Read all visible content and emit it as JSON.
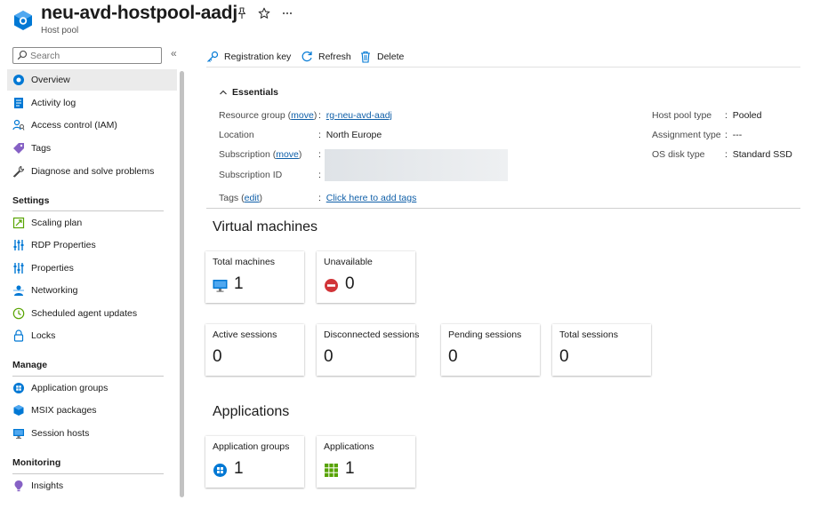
{
  "header": {
    "title": "neu-avd-hostpool-aadj",
    "subtitle": "Host pool"
  },
  "sidebar": {
    "search_placeholder": "Search",
    "collapse_glyph": "«",
    "items_top": [
      {
        "label": "Overview",
        "icon": "hostpool-icon"
      },
      {
        "label": "Activity log",
        "icon": "activity-log-icon"
      },
      {
        "label": "Access control (IAM)",
        "icon": "iam-icon"
      },
      {
        "label": "Tags",
        "icon": "tag-icon"
      },
      {
        "label": "Diagnose and solve problems",
        "icon": "wrench-icon"
      }
    ],
    "sections": [
      {
        "heading": "Settings",
        "items": [
          {
            "label": "Scaling plan",
            "icon": "scaling-plan-icon"
          },
          {
            "label": "RDP Properties",
            "icon": "sliders-icon"
          },
          {
            "label": "Properties",
            "icon": "sliders-icon"
          },
          {
            "label": "Networking",
            "icon": "network-icon"
          },
          {
            "label": "Scheduled agent updates",
            "icon": "clock-icon"
          },
          {
            "label": "Locks",
            "icon": "lock-icon"
          }
        ]
      },
      {
        "heading": "Manage",
        "items": [
          {
            "label": "Application groups",
            "icon": "app-group-icon"
          },
          {
            "label": "MSIX packages",
            "icon": "package-icon"
          },
          {
            "label": "Session hosts",
            "icon": "monitor-icon"
          }
        ]
      },
      {
        "heading": "Monitoring",
        "items": [
          {
            "label": "Insights",
            "icon": "insights-icon"
          }
        ]
      }
    ]
  },
  "toolbar": {
    "registration_key": "Registration key",
    "refresh": "Refresh",
    "delete": "Delete"
  },
  "essentials": {
    "toggle_label": "Essentials",
    "resource_group_label": "Resource group",
    "resource_group_link": "move",
    "resource_group_value": "rg-neu-avd-aadj",
    "location_label": "Location",
    "location_value": "North Europe",
    "subscription_label": "Subscription",
    "subscription_link": "move",
    "subscription_id_label": "Subscription ID",
    "tags_label": "Tags",
    "tags_edit": "edit",
    "tags_value": "Click here to add tags",
    "host_pool_type_label": "Host pool type",
    "host_pool_type_value": "Pooled",
    "assignment_type_label": "Assignment type",
    "assignment_type_value": "---",
    "os_disk_type_label": "OS disk type",
    "os_disk_type_value": "Standard SSD",
    "colon": ":"
  },
  "virtual_machines": {
    "title": "Virtual machines",
    "total_machines": {
      "label": "Total machines",
      "value": "1"
    },
    "unavailable": {
      "label": "Unavailable",
      "value": "0"
    },
    "active_sessions": {
      "label": "Active sessions",
      "value": "0"
    },
    "disconnected_sessions": {
      "label": "Disconnected sessions",
      "value": "0"
    },
    "pending_sessions": {
      "label": "Pending sessions",
      "value": "0"
    },
    "total_sessions": {
      "label": "Total sessions",
      "value": "0"
    }
  },
  "applications": {
    "title": "Applications",
    "application_groups": {
      "label": "Application groups",
      "value": "1"
    },
    "applications": {
      "label": "Applications",
      "value": "1"
    }
  },
  "colors": {
    "accent": "#0078d4",
    "link": "#0f5fa8",
    "error": "#d13438",
    "success": "#57a300"
  }
}
